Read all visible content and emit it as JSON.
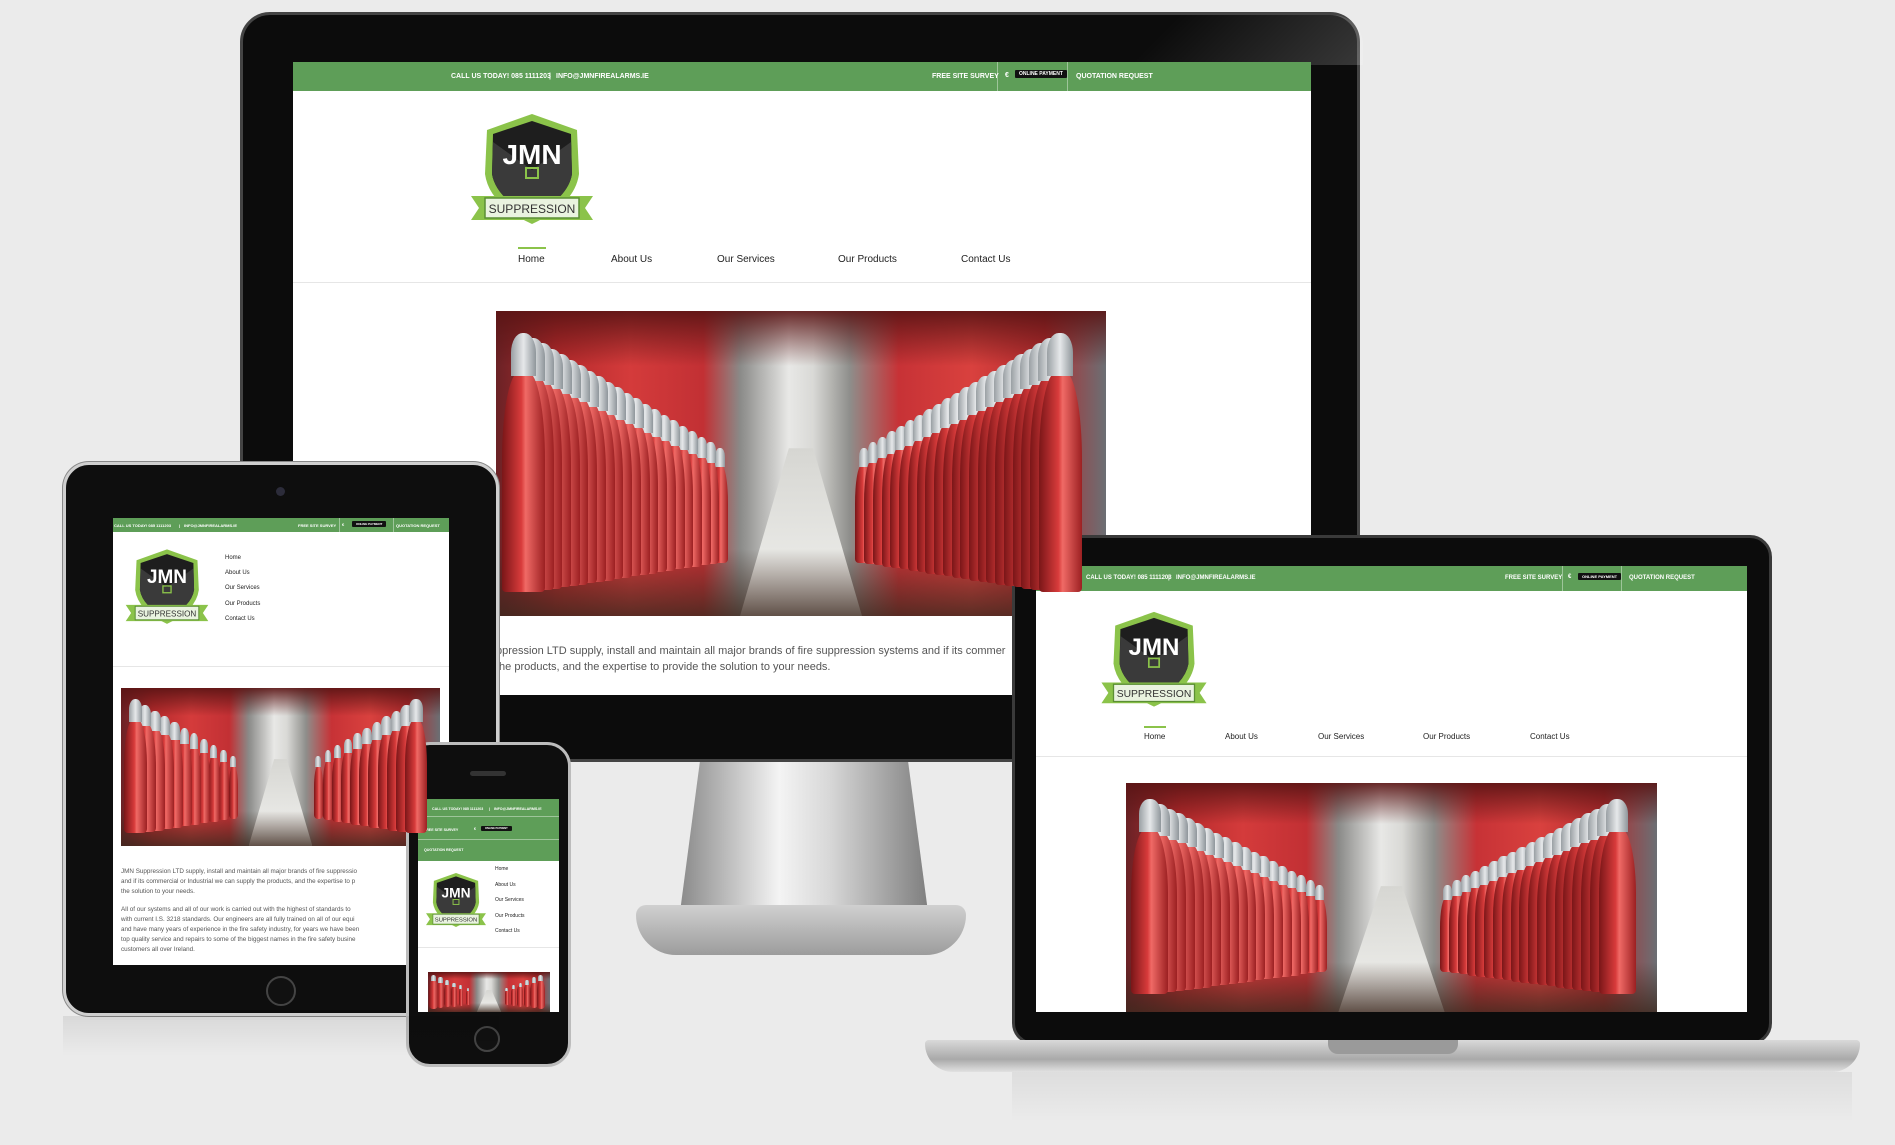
{
  "site": {
    "topbar": {
      "call": "CALL US TODAY! 085 1111203",
      "separator": "|",
      "email": "INFO@JMNFIREALARMS.IE",
      "survey": "FREE SITE SURVEY",
      "euro": "€",
      "payment": "ONLINE PAYMENT",
      "quote": "QUOTATION REQUEST"
    },
    "logo": {
      "brand": "JMN",
      "tagline": "SUPPRESSION"
    },
    "nav": [
      "Home",
      "About Us",
      "Our Services",
      "Our Products",
      "Contact Us"
    ],
    "desktop_text": [
      "ppression LTD supply, install and maintain all major brands of fire suppression systems and if its commer",
      "the products, and the expertise to provide the solution to your needs."
    ],
    "tablet_text": [
      "JMN Suppression LTD supply, install and maintain all major brands of fire suppressio",
      "and if its commercial or Industrial we can supply the products, and the expertise to p",
      "the solution to your needs.",
      "",
      "All of our systems and all of our work is carried out with the highest of standards to",
      "with current I.S. 3218 standards. Our engineers are all fully trained on all of our equi",
      "and have many years of experience in the fire safety industry, for years we have been",
      "top quality service and repairs to some of the biggest names in the fire safety busine",
      "customers all over Ireland."
    ]
  },
  "colors": {
    "accent": "#5e9e58",
    "background": "#ebebeb"
  }
}
